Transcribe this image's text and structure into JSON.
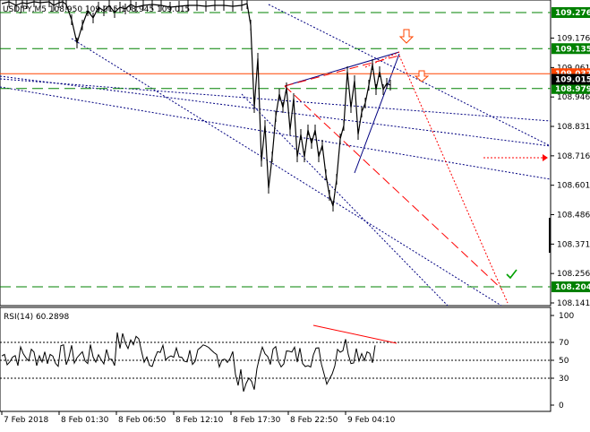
{
  "main_chart": {
    "symbol_line": "USDJPY,M5  108.950 109.015 108.945 109.015",
    "price_axis": {
      "range": [
        108.141,
        109.32
      ],
      "ticks": [
        108.141,
        108.256,
        108.371,
        108.486,
        108.601,
        108.716,
        108.831,
        108.946,
        109.061,
        109.176
      ]
    },
    "levels": [
      {
        "label": "109.276",
        "value": 109.276,
        "color": "#008000",
        "style": "dashed"
      },
      {
        "label": "109.135",
        "value": 109.135,
        "color": "#008000",
        "style": "dashed"
      },
      {
        "label": "109.037",
        "value": 109.037,
        "color": "#ff4500",
        "style": "solid"
      },
      {
        "label": "108.979",
        "value": 108.979,
        "color": "#008000",
        "style": "dashed"
      },
      {
        "label": "108.204",
        "value": 108.204,
        "color": "#008000",
        "style": "dashed"
      }
    ],
    "current_price": {
      "label": "109.015",
      "value": 109.015
    }
  },
  "rsi": {
    "title": "RSI(14) 60.2898",
    "range": [
      0,
      100
    ],
    "ticks": [
      100,
      70,
      50,
      30,
      0
    ],
    "levels": [
      70,
      50,
      30
    ]
  },
  "time_axis": {
    "labels": [
      "7 Feb 2018",
      "8 Feb 01:30",
      "8 Feb 06:50",
      "8 Feb 12:10",
      "8 Feb 17:30",
      "8 Feb 22:50",
      "9 Feb 04:10"
    ]
  },
  "colors": {
    "price_line": "#000000",
    "level_green": "#008000",
    "resistance_orange": "#ff4500",
    "trend_navy": "#000080",
    "forecast_red": "#ff0000",
    "check_green": "#00a000"
  },
  "icons": {
    "down_arrow": "down-arrow-icon",
    "check": "check-icon"
  }
}
